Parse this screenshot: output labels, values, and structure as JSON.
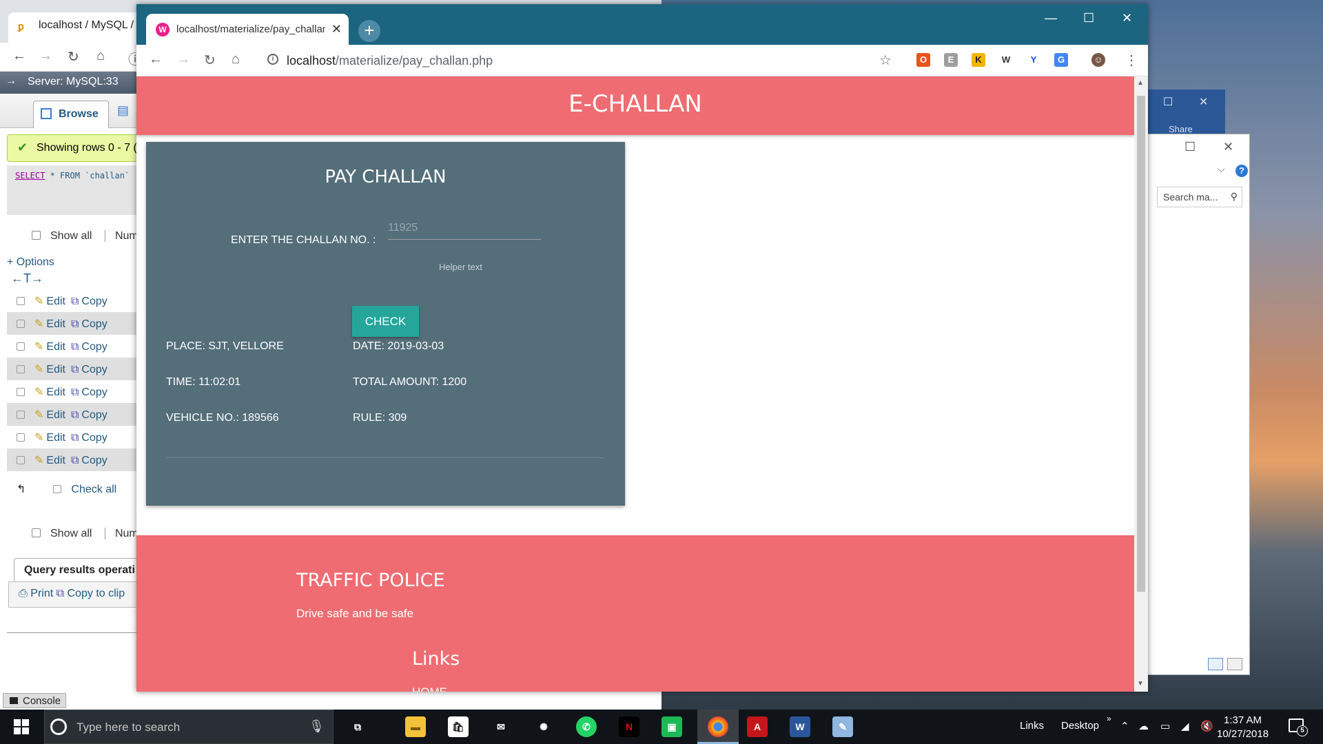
{
  "bg_browser": {
    "tab_title": "localhost / MySQL / tr",
    "server_label": "Server: MySQL:33",
    "browse_tab": "Browse",
    "success_message": "Showing rows 0 - 7 (",
    "sql_keyword": "SELECT",
    "sql_rest": " * FROM `challan`",
    "show_all": "Show all",
    "num_label": "Num",
    "options_link": "+ Options",
    "row_edit": "Edit",
    "row_copy": "Copy",
    "check_all": "Check all",
    "query_results": "Query results operati",
    "print_label": "Print",
    "copy_clip": "Copy to clip",
    "console_label": "Console"
  },
  "right_window": {
    "search_placeholder": "Search ma...",
    "share_label": "Share"
  },
  "browser": {
    "tab_title": "localhost/materialize/pay_challan.php",
    "url_host": "localhost",
    "url_path": "/materialize/pay_challan.php"
  },
  "page": {
    "header_title": "E-CHALLAN",
    "card_title": "PAY CHALLAN",
    "challan_label": "ENTER THE CHALLAN NO. :",
    "challan_value": "11925",
    "helper_text": "Helper text",
    "check_button": "CHECK",
    "place": "PLACE: SJT, VELLORE",
    "date": "DATE: 2019-03-03",
    "time": "TIME: 11:02:01",
    "total_amount": "TOTAL AMOUNT: 1200",
    "vehicle_no": "VEHICLE NO.: 189566",
    "rule": "RULE: 309",
    "footer_title": "TRAFFIC POLICE",
    "footer_text": "Drive safe and be safe",
    "links_title": "Links",
    "home_link": "HOME"
  },
  "taskbar": {
    "search_placeholder": "Type here to search",
    "links_label": "Links",
    "desktop_label": "Desktop",
    "time": "1:37 AM",
    "date": "10/27/2018",
    "notification_count": "5"
  },
  "colors": {
    "header_bg": "#ef6c72",
    "card_bg": "#546e7a",
    "button_bg": "#26a69a",
    "titlebar_bg": "#1c6580"
  }
}
